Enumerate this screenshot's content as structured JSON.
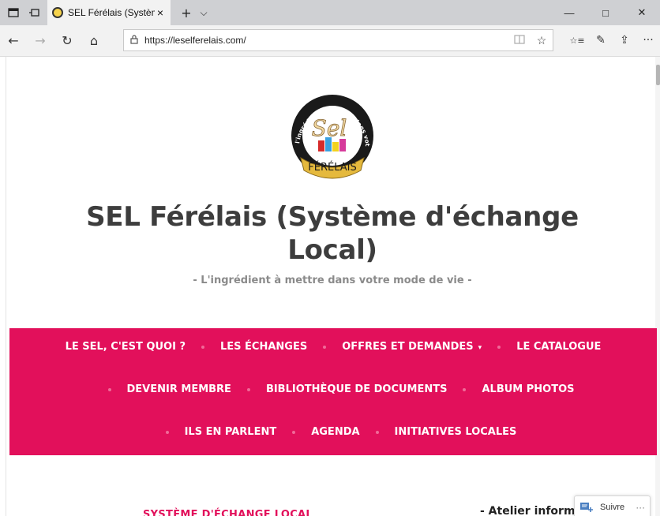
{
  "browser": {
    "tab": {
      "title": "SEL Férélais (Système d'",
      "close": "×"
    },
    "new_tab": "+",
    "tab_menu": "⌵",
    "window": {
      "minimize": "—",
      "maximize": "□",
      "close": "✕"
    },
    "nav": {
      "back": "←",
      "forward": "→",
      "refresh": "↻",
      "home": "⌂"
    },
    "address": {
      "lock": "🔒",
      "url": "https://leselferelais.com/"
    },
    "address_icons": {
      "reading_view": "📖",
      "favorite": "☆"
    },
    "tools": {
      "favorites_hub": "☆≡",
      "notes": "✎",
      "share": "⇪",
      "more": "···"
    }
  },
  "site": {
    "logo": {
      "ring_text": "l'ingrédient à mettre dans votre mode de vie !",
      "center_text": "Sel",
      "banner": "FÉRÉLAIS"
    },
    "title": "SEL Férélais (Système d'échange Local)",
    "tagline": "- L'ingrédient à mettre dans votre mode de vie -",
    "menu": {
      "row1": [
        "LE SEL, C'EST QUOI ?",
        "LES ÉCHANGES",
        "OFFRES ET DEMANDES",
        "LE CATALOGUE"
      ],
      "row2": [
        "DEVENIR MEMBRE",
        "BIBLIOTHÈQUE DE DOCUMENTS",
        "ALBUM PHOTOS"
      ],
      "row3": [
        "ILS EN PARLENT",
        "AGENDA",
        "INITIATIVES LOCALES"
      ],
      "dropdown_caret": "▾"
    },
    "section_title": "SYSTÈME D'ÉCHANGE LOCAL",
    "sidebar_title": "- Atelier informa",
    "follow": {
      "label": "Suivre",
      "more": "···"
    }
  },
  "colors": {
    "accent": "#e2105b",
    "chrome": "#cfd0d3"
  }
}
